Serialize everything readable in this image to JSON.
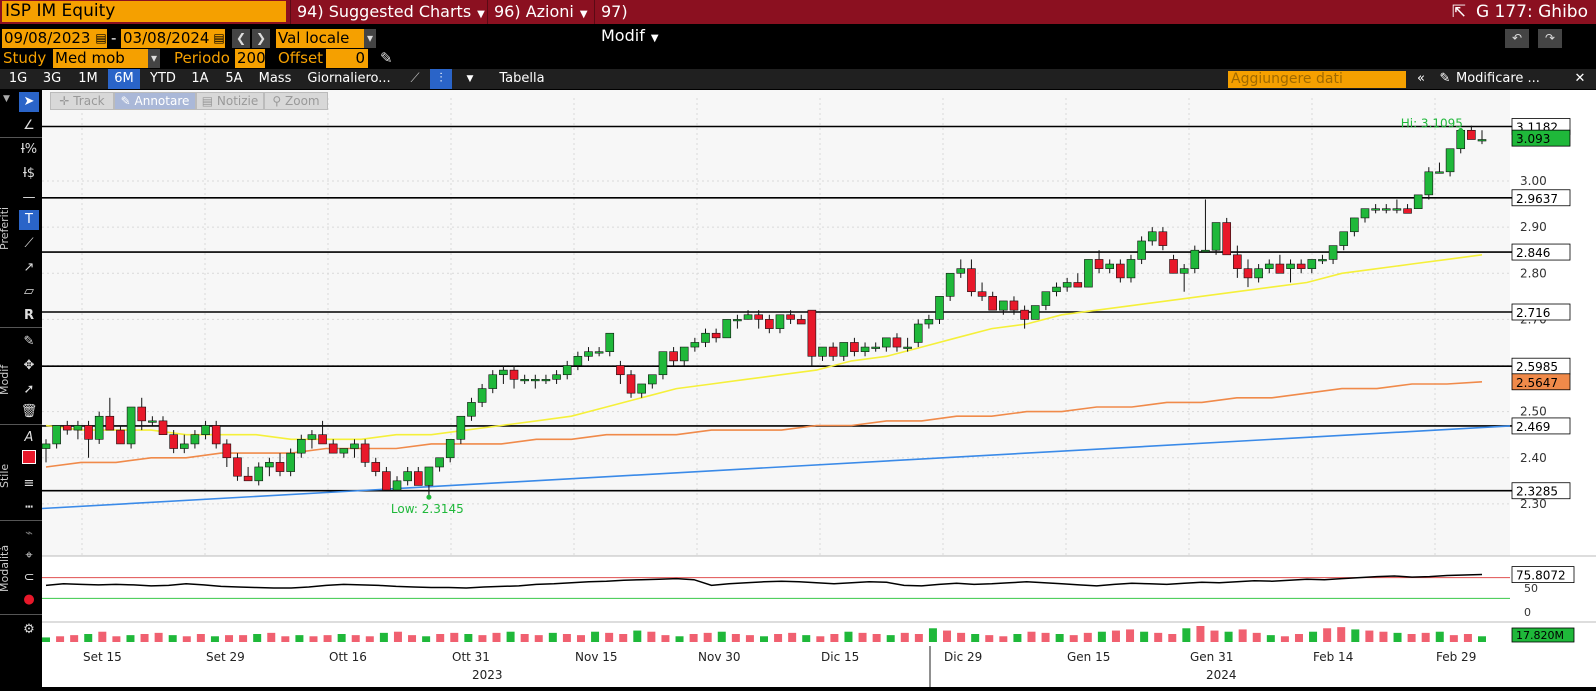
{
  "header": {
    "ticker": "ISP IM Equity",
    "menus": [
      {
        "num": "94)",
        "label": "Suggested Charts"
      },
      {
        "num": "96)",
        "label": "Azioni"
      },
      {
        "num": "97)",
        "label": "Modif"
      }
    ],
    "chart_title": "G 177: Ghibo"
  },
  "controls": {
    "start_date": "09/08/2023",
    "end_date": "03/08/2024",
    "currency": "Val locale",
    "study_label": "Study",
    "study_value": "Med mob ser",
    "period_label": "Periodo",
    "period_value": "200",
    "offset_label": "Offset",
    "offset_value": "0"
  },
  "tabs": [
    "1G",
    "3G",
    "1M",
    "6M",
    "YTD",
    "1A",
    "5A",
    "Mass",
    "Giornaliero..."
  ],
  "selected_tab": "6M",
  "table_label": "Tabella",
  "add_data_placeholder": "Aggiungere dati",
  "modify_label": "Modificare ...",
  "toolbar": {
    "track": "Track",
    "annotate": "Annotare",
    "notes": "Notizie",
    "zoom": "Zoom"
  },
  "sidebar": {
    "preferiti": "Preferiti",
    "modif": "Modif",
    "stile": "Stile",
    "modalita": "Modalità"
  },
  "colors": {
    "up": "#1fb83a",
    "down": "#e8182a",
    "ma50": "#f5f03a",
    "ma200": "#f08a4a",
    "trend": "#3a8ae8",
    "rsi": "#000000",
    "accent": "#f5a000"
  },
  "chart_data": {
    "type": "candlestick",
    "ylim": [
      2.2,
      3.18
    ],
    "y_ticks": [
      2.3,
      2.4,
      2.5,
      2.6,
      2.7,
      2.8,
      2.9,
      3.0
    ],
    "x_ticks": [
      "Set 15",
      "Set 29",
      "Ott 16",
      "Ott 31",
      "Nov 15",
      "Nov 30",
      "Dic 15",
      "Dic 29",
      "Gen 15",
      "Gen 31",
      "Feb 14",
      "Feb 29"
    ],
    "years": [
      "2023",
      "2024"
    ],
    "hi_label": "Hi: 3.1095",
    "low_label": "Low: 2.3145",
    "price_levels": [
      {
        "value": 3.1182,
        "label": "3.1182"
      },
      {
        "value": 2.9637,
        "label": "2.9637"
      },
      {
        "value": 2.846,
        "label": "2.846"
      },
      {
        "value": 2.716,
        "label": "2.716"
      },
      {
        "value": 2.5985,
        "label": "2.5985"
      },
      {
        "value": 2.469,
        "label": "2.469"
      },
      {
        "value": 2.3285,
        "label": "2.3285"
      }
    ],
    "last_price": {
      "value": 3.093,
      "label": "3.093"
    },
    "ma200_last": {
      "value": 2.5647,
      "label": "2.5647"
    },
    "candles": [
      [
        2.42,
        2.44,
        2.39,
        2.43
      ],
      [
        2.43,
        2.47,
        2.42,
        2.47
      ],
      [
        2.47,
        2.48,
        2.45,
        2.46
      ],
      [
        2.46,
        2.48,
        2.44,
        2.47
      ],
      [
        2.47,
        2.48,
        2.4,
        2.44
      ],
      [
        2.44,
        2.5,
        2.43,
        2.49
      ],
      [
        2.49,
        2.53,
        2.47,
        2.46
      ],
      [
        2.46,
        2.47,
        2.43,
        2.43
      ],
      [
        2.43,
        2.48,
        2.42,
        2.51
      ],
      [
        2.51,
        2.53,
        2.46,
        2.48
      ],
      [
        2.48,
        2.49,
        2.47,
        2.48
      ],
      [
        2.48,
        2.49,
        2.45,
        2.45
      ],
      [
        2.45,
        2.46,
        2.41,
        2.42
      ],
      [
        2.42,
        2.45,
        2.41,
        2.43
      ],
      [
        2.43,
        2.46,
        2.42,
        2.45
      ],
      [
        2.45,
        2.48,
        2.44,
        2.47
      ],
      [
        2.47,
        2.48,
        2.42,
        2.43
      ],
      [
        2.43,
        2.44,
        2.38,
        2.4
      ],
      [
        2.4,
        2.41,
        2.35,
        2.36
      ],
      [
        2.36,
        2.38,
        2.35,
        2.35
      ],
      [
        2.35,
        2.39,
        2.34,
        2.38
      ],
      [
        2.38,
        2.4,
        2.36,
        2.39
      ],
      [
        2.39,
        2.41,
        2.36,
        2.37
      ],
      [
        2.37,
        2.42,
        2.36,
        2.41
      ],
      [
        2.41,
        2.45,
        2.4,
        2.44
      ],
      [
        2.44,
        2.46,
        2.42,
        2.45
      ],
      [
        2.45,
        2.48,
        2.44,
        2.43
      ],
      [
        2.43,
        2.44,
        2.41,
        2.41
      ],
      [
        2.41,
        2.42,
        2.4,
        2.42
      ],
      [
        2.42,
        2.44,
        2.4,
        2.43
      ],
      [
        2.43,
        2.44,
        2.38,
        2.39
      ],
      [
        2.39,
        2.4,
        2.36,
        2.37
      ],
      [
        2.37,
        2.38,
        2.33,
        2.33
      ],
      [
        2.33,
        2.36,
        2.33,
        2.35
      ],
      [
        2.35,
        2.38,
        2.34,
        2.37
      ],
      [
        2.37,
        2.38,
        2.34,
        2.34
      ],
      [
        2.34,
        2.38,
        2.31,
        2.38
      ],
      [
        2.38,
        2.4,
        2.37,
        2.4
      ],
      [
        2.4,
        2.44,
        2.39,
        2.44
      ],
      [
        2.44,
        2.49,
        2.43,
        2.49
      ],
      [
        2.49,
        2.53,
        2.48,
        2.52
      ],
      [
        2.52,
        2.56,
        2.51,
        2.55
      ],
      [
        2.55,
        2.59,
        2.54,
        2.58
      ],
      [
        2.58,
        2.6,
        2.56,
        2.59
      ],
      [
        2.59,
        2.6,
        2.55,
        2.57
      ],
      [
        2.57,
        2.58,
        2.56,
        2.57
      ],
      [
        2.57,
        2.58,
        2.55,
        2.57
      ],
      [
        2.57,
        2.58,
        2.56,
        2.57
      ],
      [
        2.57,
        2.59,
        2.56,
        2.58
      ],
      [
        2.58,
        2.61,
        2.57,
        2.6
      ],
      [
        2.6,
        2.63,
        2.59,
        2.62
      ],
      [
        2.62,
        2.64,
        2.61,
        2.63
      ],
      [
        2.63,
        2.64,
        2.62,
        2.63
      ],
      [
        2.63,
        2.67,
        2.62,
        2.67
      ],
      [
        2.6,
        2.61,
        2.56,
        2.58
      ],
      [
        2.58,
        2.59,
        2.53,
        2.54
      ],
      [
        2.54,
        2.56,
        2.53,
        2.56
      ],
      [
        2.56,
        2.58,
        2.55,
        2.58
      ],
      [
        2.58,
        2.63,
        2.57,
        2.63
      ],
      [
        2.63,
        2.64,
        2.6,
        2.61
      ],
      [
        2.61,
        2.64,
        2.6,
        2.64
      ],
      [
        2.64,
        2.66,
        2.63,
        2.65
      ],
      [
        2.65,
        2.68,
        2.64,
        2.67
      ],
      [
        2.67,
        2.68,
        2.65,
        2.66
      ],
      [
        2.66,
        2.7,
        2.66,
        2.7
      ],
      [
        2.7,
        2.71,
        2.68,
        2.7
      ],
      [
        2.7,
        2.72,
        2.7,
        2.71
      ],
      [
        2.71,
        2.72,
        2.68,
        2.7
      ],
      [
        2.7,
        2.71,
        2.67,
        2.68
      ],
      [
        2.68,
        2.71,
        2.67,
        2.71
      ],
      [
        2.71,
        2.72,
        2.69,
        2.7
      ],
      [
        2.7,
        2.71,
        2.69,
        2.69
      ],
      [
        2.72,
        2.72,
        2.6,
        2.62
      ],
      [
        2.62,
        2.64,
        2.61,
        2.64
      ],
      [
        2.64,
        2.65,
        2.61,
        2.62
      ],
      [
        2.62,
        2.65,
        2.61,
        2.65
      ],
      [
        2.65,
        2.66,
        2.62,
        2.63
      ],
      [
        2.63,
        2.65,
        2.62,
        2.64
      ],
      [
        2.64,
        2.65,
        2.63,
        2.64
      ],
      [
        2.64,
        2.66,
        2.63,
        2.66
      ],
      [
        2.66,
        2.67,
        2.63,
        2.64
      ],
      [
        2.64,
        2.66,
        2.63,
        2.64
      ],
      [
        2.65,
        2.7,
        2.64,
        2.69
      ],
      [
        2.69,
        2.71,
        2.68,
        2.7
      ],
      [
        2.7,
        2.75,
        2.69,
        2.75
      ],
      [
        2.75,
        2.8,
        2.74,
        2.8
      ],
      [
        2.8,
        2.83,
        2.79,
        2.81
      ],
      [
        2.81,
        2.83,
        2.75,
        2.76
      ],
      [
        2.76,
        2.78,
        2.74,
        2.75
      ],
      [
        2.75,
        2.76,
        2.72,
        2.72
      ],
      [
        2.72,
        2.74,
        2.71,
        2.74
      ],
      [
        2.74,
        2.75,
        2.71,
        2.72
      ],
      [
        2.72,
        2.73,
        2.68,
        2.7
      ],
      [
        2.7,
        2.73,
        2.7,
        2.73
      ],
      [
        2.73,
        2.76,
        2.72,
        2.76
      ],
      [
        2.76,
        2.78,
        2.75,
        2.77
      ],
      [
        2.77,
        2.79,
        2.76,
        2.78
      ],
      [
        2.78,
        2.8,
        2.77,
        2.77
      ],
      [
        2.77,
        2.83,
        2.77,
        2.83
      ],
      [
        2.83,
        2.85,
        2.8,
        2.81
      ],
      [
        2.81,
        2.83,
        2.8,
        2.82
      ],
      [
        2.82,
        2.83,
        2.78,
        2.79
      ],
      [
        2.79,
        2.84,
        2.78,
        2.83
      ],
      [
        2.83,
        2.88,
        2.82,
        2.87
      ],
      [
        2.87,
        2.9,
        2.86,
        2.89
      ],
      [
        2.89,
        2.9,
        2.85,
        2.86
      ],
      [
        2.83,
        2.84,
        2.8,
        2.8
      ],
      [
        2.8,
        2.82,
        2.76,
        2.81
      ],
      [
        2.81,
        2.86,
        2.8,
        2.85
      ],
      [
        2.85,
        2.96,
        2.85,
        2.85
      ],
      [
        2.85,
        2.91,
        2.84,
        2.91
      ],
      [
        2.91,
        2.92,
        2.84,
        2.84
      ],
      [
        2.84,
        2.86,
        2.79,
        2.81
      ],
      [
        2.81,
        2.83,
        2.77,
        2.79
      ],
      [
        2.79,
        2.82,
        2.78,
        2.81
      ],
      [
        2.81,
        2.83,
        2.8,
        2.82
      ],
      [
        2.82,
        2.84,
        2.81,
        2.8
      ],
      [
        2.81,
        2.83,
        2.78,
        2.82
      ],
      [
        2.82,
        2.83,
        2.8,
        2.81
      ],
      [
        2.81,
        2.83,
        2.8,
        2.83
      ],
      [
        2.83,
        2.84,
        2.82,
        2.83
      ],
      [
        2.83,
        2.86,
        2.82,
        2.86
      ],
      [
        2.86,
        2.89,
        2.85,
        2.89
      ],
      [
        2.89,
        2.92,
        2.88,
        2.92
      ],
      [
        2.92,
        2.94,
        2.91,
        2.94
      ],
      [
        2.94,
        2.95,
        2.93,
        2.94
      ],
      [
        2.94,
        2.95,
        2.93,
        2.94
      ],
      [
        2.94,
        2.96,
        2.93,
        2.94
      ],
      [
        2.94,
        2.95,
        2.93,
        2.93
      ],
      [
        2.94,
        2.97,
        2.94,
        2.97
      ],
      [
        2.97,
        3.03,
        2.96,
        3.02
      ],
      [
        3.02,
        3.04,
        3.02,
        3.02
      ],
      [
        3.02,
        3.07,
        3.01,
        3.07
      ],
      [
        3.07,
        3.11,
        3.06,
        3.11
      ],
      [
        3.11,
        3.12,
        3.09,
        3.09
      ],
      [
        3.09,
        3.11,
        3.08,
        3.09
      ]
    ],
    "ma50": [
      2.47,
      2.46,
      2.46,
      2.46,
      2.45,
      2.45,
      2.45,
      2.44,
      2.44,
      2.44,
      2.45,
      2.45,
      2.46,
      2.47,
      2.48,
      2.49,
      2.51,
      2.53,
      2.55,
      2.56,
      2.57,
      2.58,
      2.59,
      2.61,
      2.62,
      2.64,
      2.66,
      2.68,
      2.69,
      2.71,
      2.72,
      2.73,
      2.74,
      2.75,
      2.76,
      2.77,
      2.78,
      2.8,
      2.81,
      2.82,
      2.83,
      2.84
    ],
    "ma200": [
      2.38,
      2.39,
      2.39,
      2.4,
      2.4,
      2.41,
      2.41,
      2.41,
      2.42,
      2.42,
      2.42,
      2.43,
      2.43,
      2.43,
      2.44,
      2.44,
      2.45,
      2.45,
      2.45,
      2.46,
      2.46,
      2.46,
      2.47,
      2.47,
      2.48,
      2.48,
      2.49,
      2.49,
      2.5,
      2.5,
      2.51,
      2.51,
      2.52,
      2.52,
      2.53,
      2.53,
      2.54,
      2.55,
      2.55,
      2.56,
      2.56,
      2.5647
    ],
    "trend": [
      2.29,
      2.469
    ],
    "rsi": {
      "last_label": "75.8072",
      "ticks": [
        "50",
        "0"
      ],
      "values": [
        55,
        58,
        57,
        56,
        57,
        56,
        54,
        55,
        58,
        56,
        53,
        52,
        51,
        50,
        50,
        52,
        55,
        57,
        56,
        55,
        53,
        52,
        51,
        51,
        50,
        52,
        53,
        54,
        57,
        58,
        60,
        62,
        63,
        65,
        66,
        67,
        68,
        66,
        55,
        58,
        60,
        62,
        63,
        62,
        60,
        58,
        60,
        62,
        61,
        55,
        54,
        57,
        59,
        57,
        58,
        60,
        62,
        60,
        58,
        56,
        54,
        57,
        59,
        58,
        57,
        59,
        61,
        60,
        62,
        64,
        63,
        65,
        67,
        66,
        68,
        70,
        72,
        73,
        71,
        72,
        74,
        75,
        76
      ]
    },
    "volume": {
      "last_label": "17.820M",
      "values": [
        4,
        5,
        6,
        7,
        9,
        5,
        6,
        7,
        8,
        6,
        5,
        7,
        5,
        6,
        6,
        7,
        8,
        5,
        6,
        5,
        6,
        7,
        6,
        5,
        8,
        9,
        6,
        5,
        7,
        8,
        7,
        6,
        8,
        9,
        7,
        6,
        8,
        7,
        6,
        9,
        8,
        7,
        10,
        9,
        6,
        5,
        7,
        8,
        9,
        7,
        6,
        5,
        7,
        8,
        6,
        5,
        7,
        9,
        8,
        7,
        6,
        8,
        7,
        12,
        10,
        8,
        7,
        6,
        5,
        7,
        9,
        8,
        7,
        6,
        8,
        9,
        10,
        11,
        9,
        8,
        7,
        12,
        14,
        10,
        9,
        11,
        8,
        6,
        5,
        7,
        9,
        12,
        13,
        11,
        10,
        9,
        8,
        7,
        8,
        9,
        6,
        7,
        5
      ]
    }
  }
}
